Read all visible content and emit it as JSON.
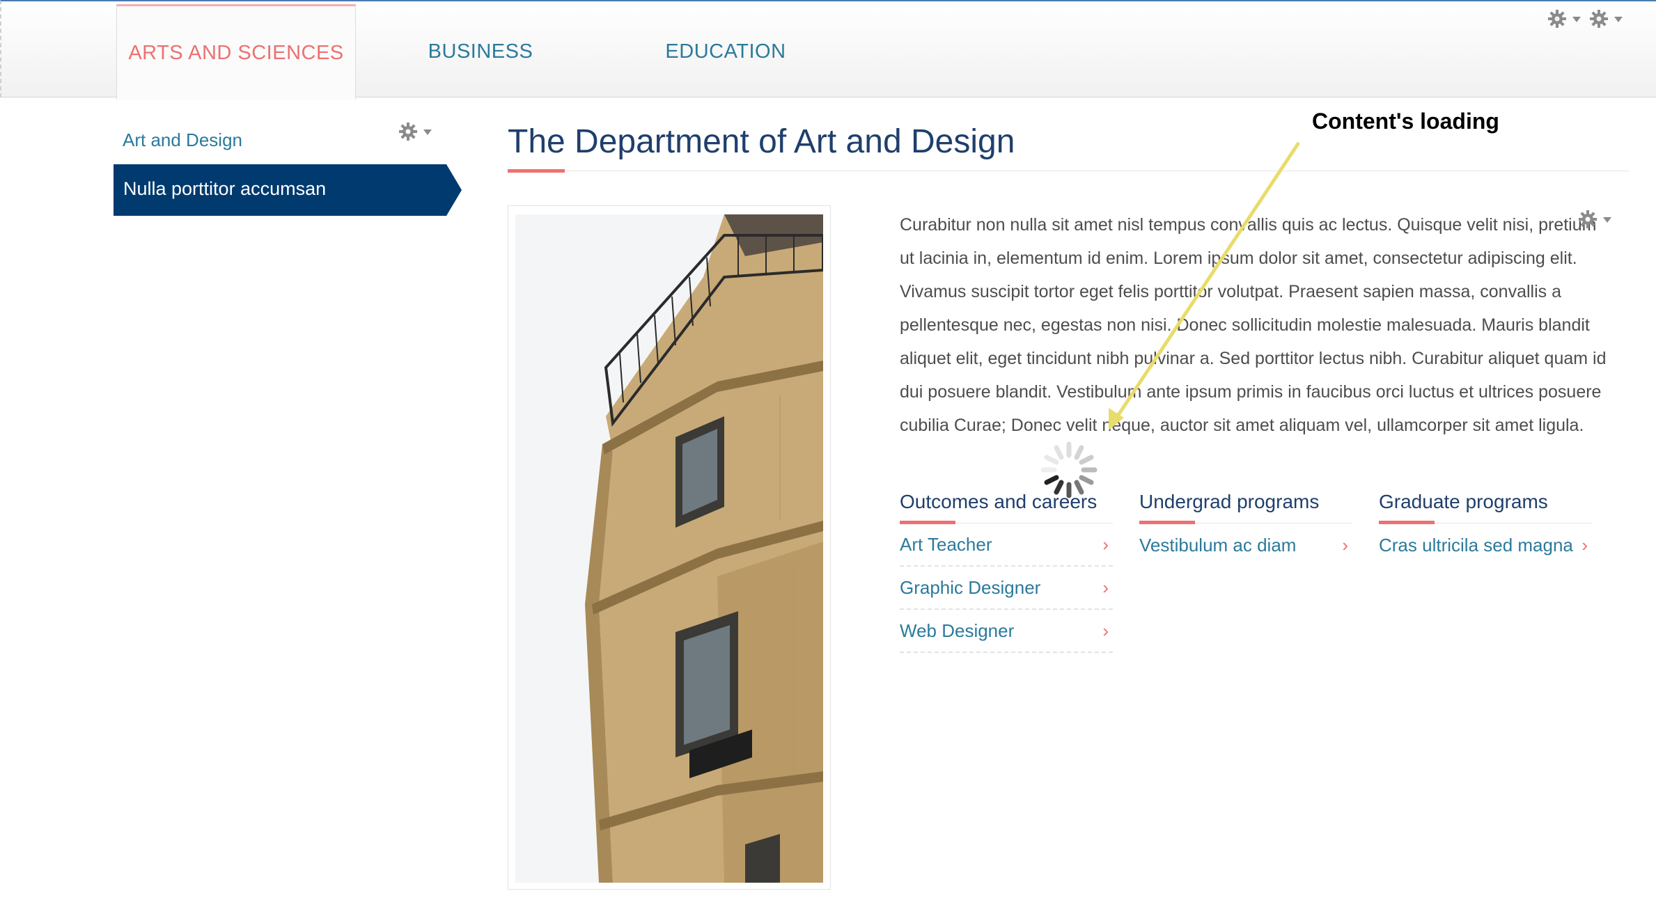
{
  "nav": {
    "tabs": [
      {
        "label": "ARTS AND SCIENCES",
        "active": true
      },
      {
        "label": "BUSINESS",
        "active": false
      },
      {
        "label": "EDUCATION",
        "active": false
      }
    ]
  },
  "sidebar": {
    "items": [
      {
        "label": "Art and Design"
      },
      {
        "label": "Nulla porttitor accumsan",
        "active": true
      }
    ]
  },
  "main": {
    "title": "The Department of Art and Design",
    "paragraph": "Curabitur non nulla sit amet nisl tempus convallis quis ac lectus. Quisque velit nisi, pretium ut lacinia in, elementum id enim. Lorem ipsum dolor sit amet, consectetur adipiscing elit. Vivamus suscipit tortor eget felis porttitor volutpat. Praesent sapien massa, convallis a pellentesque nec, egestas non nisi. Donec sollicitudin molestie malesuada. Mauris blandit aliquet elit, eget tincidunt nibh pulvinar a. Sed porttitor lectus nibh. Curabitur aliquet quam id dui posuere blandit. Vestibulum ante ipsum primis in faucibus orci luctus et ultrices posuere cubilia Curae; Donec velit neque, auctor sit amet aliquam vel, ullamcorper sit amet ligula.",
    "columns": [
      {
        "heading": "Outcomes and careers",
        "items": [
          "Art Teacher",
          "Graphic Designer",
          "Web Designer"
        ]
      },
      {
        "heading": "Undergrad programs",
        "items": [
          "Vestibulum ac diam"
        ]
      },
      {
        "heading": "Graduate programs",
        "items": [
          "Cras ultricila sed magna"
        ]
      }
    ]
  },
  "annotation": {
    "text": "Content's loading"
  },
  "colors": {
    "accent": "#ee7070",
    "link": "#2b7a9b",
    "navy": "#1f3f6c",
    "sidebar_active": "#003a6e",
    "annotation_arrow": "#e8dc6a"
  },
  "icons": [
    "gear-icon",
    "chevron-right-icon",
    "loading-spinner-icon"
  ]
}
